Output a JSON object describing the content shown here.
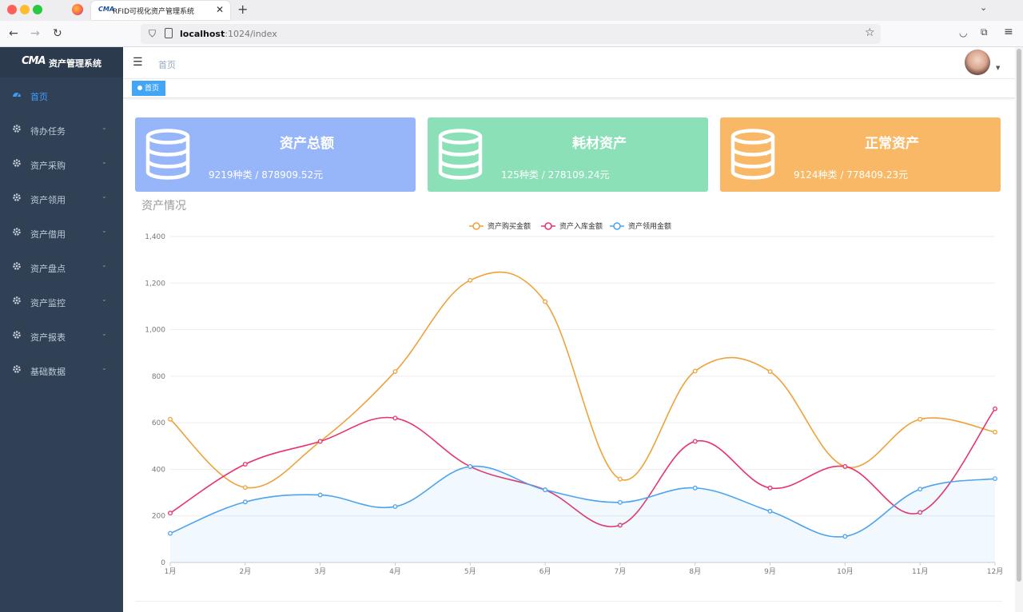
{
  "browser": {
    "tab_logo": "CMA",
    "tab_title": "RFID可视化资产管理系统",
    "url_host": "localhost",
    "url_path": ":1024/index"
  },
  "app": {
    "logo_text": "CMA",
    "name": "资产管理系统"
  },
  "sidebar": {
    "items": [
      {
        "label": "首页",
        "active": true
      },
      {
        "label": "待办任务"
      },
      {
        "label": "资产采购"
      },
      {
        "label": "资产领用"
      },
      {
        "label": "资产借用"
      },
      {
        "label": "资产盘点"
      },
      {
        "label": "资产监控"
      },
      {
        "label": "资产报表"
      },
      {
        "label": "基础数据"
      }
    ]
  },
  "header": {
    "breadcrumb": "首页",
    "active_tag": "首页"
  },
  "cards": [
    {
      "title": "资产总额",
      "subtitle": "9219种类 / 878909.52元",
      "color": "#97b6f9"
    },
    {
      "title": "耗材资产",
      "subtitle": "125种类 / 278109.24元",
      "color": "#8be0b8"
    },
    {
      "title": "正常资产",
      "subtitle": "9124种类 / 778409.23元",
      "color": "#f8b865"
    }
  ],
  "section_title": "资产情况",
  "chart_data": {
    "type": "line",
    "categories": [
      "1月",
      "2月",
      "3月",
      "4月",
      "5月",
      "6月",
      "7月",
      "8月",
      "9月",
      "10月",
      "11月",
      "12月"
    ],
    "yticks": [
      "0",
      "200",
      "400",
      "600",
      "800",
      "1,000",
      "1,200",
      "1,400"
    ],
    "ylim": [
      0,
      1400
    ],
    "legend_position": "top-center",
    "grid": true,
    "series": [
      {
        "name": "资产购买金额",
        "color": "#eea23b",
        "values": [
          615,
          322,
          520,
          820,
          1212,
          1120,
          358,
          822,
          820,
          412,
          615,
          560
        ]
      },
      {
        "name": "资产入库金额",
        "color": "#e8336b",
        "values": [
          212,
          422,
          520,
          620,
          412,
          312,
          160,
          520,
          320,
          412,
          215,
          660
        ]
      },
      {
        "name": "资产领用金额",
        "color": "#4ca3ee",
        "area": true,
        "values": [
          125,
          260,
          290,
          240,
          412,
          312,
          258,
          320,
          220,
          112,
          315,
          360
        ]
      }
    ]
  }
}
